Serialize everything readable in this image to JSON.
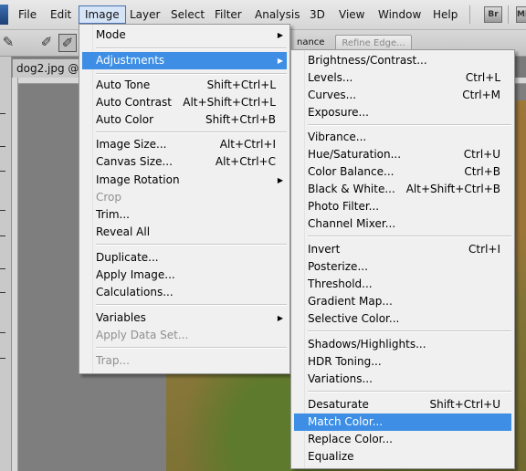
{
  "menubar": {
    "items": [
      "File",
      "Edit",
      "Image",
      "Layer",
      "Select",
      "Filter",
      "Analysis",
      "3D",
      "View",
      "Window",
      "Help"
    ],
    "active": "Image",
    "right_buttons": [
      "Br",
      "Mb"
    ]
  },
  "options_bar": {
    "enhance_label": "nance",
    "refine_edge_label": "Refine Edge..."
  },
  "document": {
    "tab_title": "dog2.jpg @"
  },
  "image_menu": {
    "items": [
      {
        "label": "Mode",
        "shortcut": "",
        "submenu": true
      },
      {
        "label": "Adjustments",
        "shortcut": "",
        "submenu": true,
        "highlighted": true
      },
      {
        "label": "Auto Tone",
        "shortcut": "Shift+Ctrl+L"
      },
      {
        "label": "Auto Contrast",
        "shortcut": "Alt+Shift+Ctrl+L"
      },
      {
        "label": "Auto Color",
        "shortcut": "Shift+Ctrl+B"
      },
      {
        "label": "Image Size...",
        "shortcut": "Alt+Ctrl+I"
      },
      {
        "label": "Canvas Size...",
        "shortcut": "Alt+Ctrl+C"
      },
      {
        "label": "Image Rotation",
        "shortcut": "",
        "submenu": true
      },
      {
        "label": "Crop",
        "shortcut": "",
        "disabled": true
      },
      {
        "label": "Trim...",
        "shortcut": ""
      },
      {
        "label": "Reveal All",
        "shortcut": ""
      },
      {
        "label": "Duplicate...",
        "shortcut": ""
      },
      {
        "label": "Apply Image...",
        "shortcut": ""
      },
      {
        "label": "Calculations...",
        "shortcut": ""
      },
      {
        "label": "Variables",
        "shortcut": "",
        "submenu": true
      },
      {
        "label": "Apply Data Set...",
        "shortcut": "",
        "disabled": true
      },
      {
        "label": "Trap...",
        "shortcut": "",
        "disabled": true
      }
    ]
  },
  "adjustments_menu": {
    "items": [
      {
        "label": "Brightness/Contrast...",
        "shortcut": ""
      },
      {
        "label": "Levels...",
        "shortcut": "Ctrl+L"
      },
      {
        "label": "Curves...",
        "shortcut": "Ctrl+M"
      },
      {
        "label": "Exposure...",
        "shortcut": ""
      },
      {
        "label": "Vibrance...",
        "shortcut": ""
      },
      {
        "label": "Hue/Saturation...",
        "shortcut": "Ctrl+U"
      },
      {
        "label": "Color Balance...",
        "shortcut": "Ctrl+B"
      },
      {
        "label": "Black & White...",
        "shortcut": "Alt+Shift+Ctrl+B"
      },
      {
        "label": "Photo Filter...",
        "shortcut": ""
      },
      {
        "label": "Channel Mixer...",
        "shortcut": ""
      },
      {
        "label": "Invert",
        "shortcut": "Ctrl+I"
      },
      {
        "label": "Posterize...",
        "shortcut": ""
      },
      {
        "label": "Threshold...",
        "shortcut": ""
      },
      {
        "label": "Gradient Map...",
        "shortcut": ""
      },
      {
        "label": "Selective Color...",
        "shortcut": ""
      },
      {
        "label": "Shadows/Highlights...",
        "shortcut": ""
      },
      {
        "label": "HDR Toning...",
        "shortcut": ""
      },
      {
        "label": "Variations...",
        "shortcut": ""
      },
      {
        "label": "Desaturate",
        "shortcut": "Shift+Ctrl+U"
      },
      {
        "label": "Match Color...",
        "shortcut": "",
        "highlighted": true
      },
      {
        "label": "Replace Color...",
        "shortcut": ""
      },
      {
        "label": "Equalize",
        "shortcut": ""
      }
    ]
  }
}
